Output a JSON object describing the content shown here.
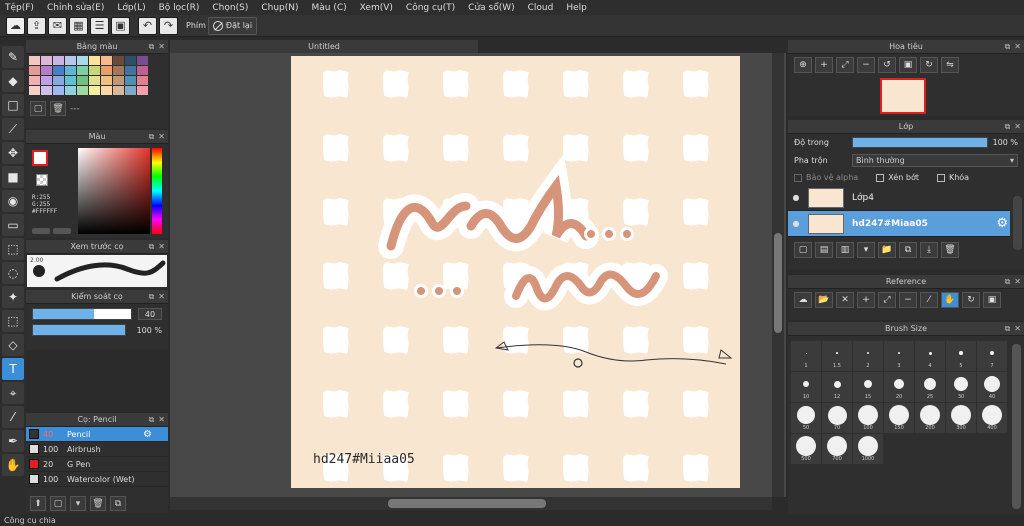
{
  "menu": [
    "Tệp(F)",
    "Chỉnh sửa(E)",
    "Lớp(L)",
    "Bộ lọc(R)",
    "Chọn(S)",
    "Chụp(N)",
    "Màu (C)",
    "Xem(V)",
    "Công cụ(T)",
    "Cửa sổ(W)",
    "Cloud",
    "Help"
  ],
  "toolbar": {
    "keys_label": "Phím",
    "reset_label": "Đặt lại"
  },
  "palette": {
    "title": "Bảng màu",
    "footer_text": "---",
    "colors": [
      "#f4c7c3",
      "#d9b8d8",
      "#c9b5e0",
      "#b8c8ea",
      "#a9d8ec",
      "#ffe39b",
      "#f8b98c",
      "#6b4a3a",
      "#2f4e6b",
      "#7a4e8c",
      "#e59a9a",
      "#b27ec4",
      "#4a7fc6",
      "#5fb6d4",
      "#7fd0a0",
      "#c9d67a",
      "#e8a06a",
      "#a57658",
      "#41739c",
      "#c06090",
      "#f0b0b0",
      "#bfa0e0",
      "#88a8e0",
      "#60c0d0",
      "#70c080",
      "#e0e090",
      "#f0c080",
      "#c09878",
      "#5090b0",
      "#e08090",
      "#f8d0c8",
      "#d0c0e8",
      "#a0b8f0",
      "#90d0e0",
      "#a0d8a0",
      "#f0f0a0",
      "#f8d8a8",
      "#d8b898",
      "#80a8c8",
      "#f0a0b0"
    ]
  },
  "color": {
    "title": "Màu",
    "r": "R:255",
    "g": "G:255",
    "hex": "#FFFFFF",
    "fg": "#ffffff"
  },
  "brush_preview": {
    "title": "Xem trước cọ",
    "size": "2.00"
  },
  "brush_control": {
    "title": "Kiểm soát cọ",
    "size": "40",
    "size_fraction": 0.62,
    "opacity": "100 %",
    "opacity_fraction": 1.0
  },
  "brush_list": {
    "title": "Cọ: Pencil",
    "items": [
      {
        "size": "40",
        "name": "Pencil",
        "swatch": "#333333",
        "selected": true
      },
      {
        "size": "100",
        "name": "Airbrush",
        "swatch": "#dddddd",
        "selected": false
      },
      {
        "size": "20",
        "name": "G Pen",
        "swatch": "#e02020",
        "selected": false
      },
      {
        "size": "100",
        "name": "Watercolor (Wet)",
        "swatch": "#dddddd",
        "selected": false
      }
    ]
  },
  "document": {
    "tab_title": "Untitled",
    "credit": "hd247#Miiaa05"
  },
  "navigator": {
    "title": "Hoa tiêu"
  },
  "layer": {
    "title": "Lớp",
    "opacity_label": "Độ trong",
    "opacity_value": "100 %",
    "blend_label": "Pha trộn",
    "blend_value": "Bình thường",
    "protect_alpha": "Bảo vệ alpha",
    "clipping": "Xén bớt",
    "lock": "Khóa",
    "layers": [
      {
        "name": "Lớp4",
        "selected": false
      },
      {
        "name": "hd247#Miaa05",
        "selected": true
      }
    ]
  },
  "reference": {
    "title": "Reference"
  },
  "brush_size": {
    "title": "Brush Size",
    "sizes": [
      "1",
      "1.5",
      "2",
      "3",
      "4",
      "5",
      "7",
      "10",
      "12",
      "15",
      "20",
      "25",
      "30",
      "40",
      "50",
      "70",
      "100",
      "150",
      "200",
      "300",
      "400",
      "500",
      "700",
      "1000"
    ]
  },
  "status": "Công cụ chia"
}
